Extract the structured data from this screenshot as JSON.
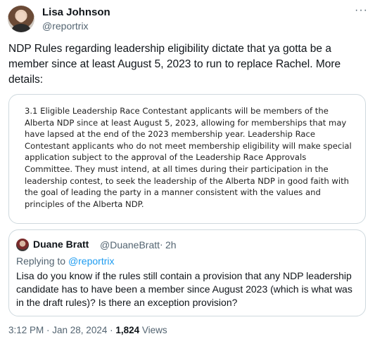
{
  "author": {
    "name": "Lisa Johnson",
    "handle": "@reportrix",
    "avatar_icon": "profile-photo"
  },
  "more_icon_glyph": "···",
  "tweet": {
    "text": "NDP Rules regarding leadership eligibility dictate that ya gotta be a member since at least August 5, 2023 to run to replace Rachel. More details:"
  },
  "attached_image": {
    "text": "3.1 Eligible Leadership Race Contestant applicants will be members of the Alberta NDP since at least August 5, 2023, allowing for memberships that may have lapsed at the end of the 2023 membership year. Leadership Race Contestant applicants who do not meet membership eligibility will make special application subject to the approval of the Leadership Race Approvals Committee. They must intend, at all times during their participation in the leadership contest, to seek the leadership of the Alberta NDP in good faith with the goal of leading the party in a manner consistent with the values and principles of the Alberta NDP."
  },
  "quoted_tweet": {
    "name": "Duane Bratt",
    "handle": "@DuaneBratt",
    "separator": "·",
    "time": "2h",
    "replying_prefix": "Replying to",
    "replying_to": "@reportrix",
    "text": "Lisa do you know if the rules still contain a provision that any NDP leadership candidate has to have been a member since August 2023 (which is what was in the draft rules)? Is there an exception provision?"
  },
  "meta": {
    "timestamp": "3:12 PM · Jan 28, 2024 ·",
    "views_count": "1,824",
    "views_label": "Views"
  },
  "colors": {
    "text_primary": "#0f1419",
    "text_secondary": "#536471",
    "link": "#1d9bf0",
    "border": "#cfd9de"
  }
}
